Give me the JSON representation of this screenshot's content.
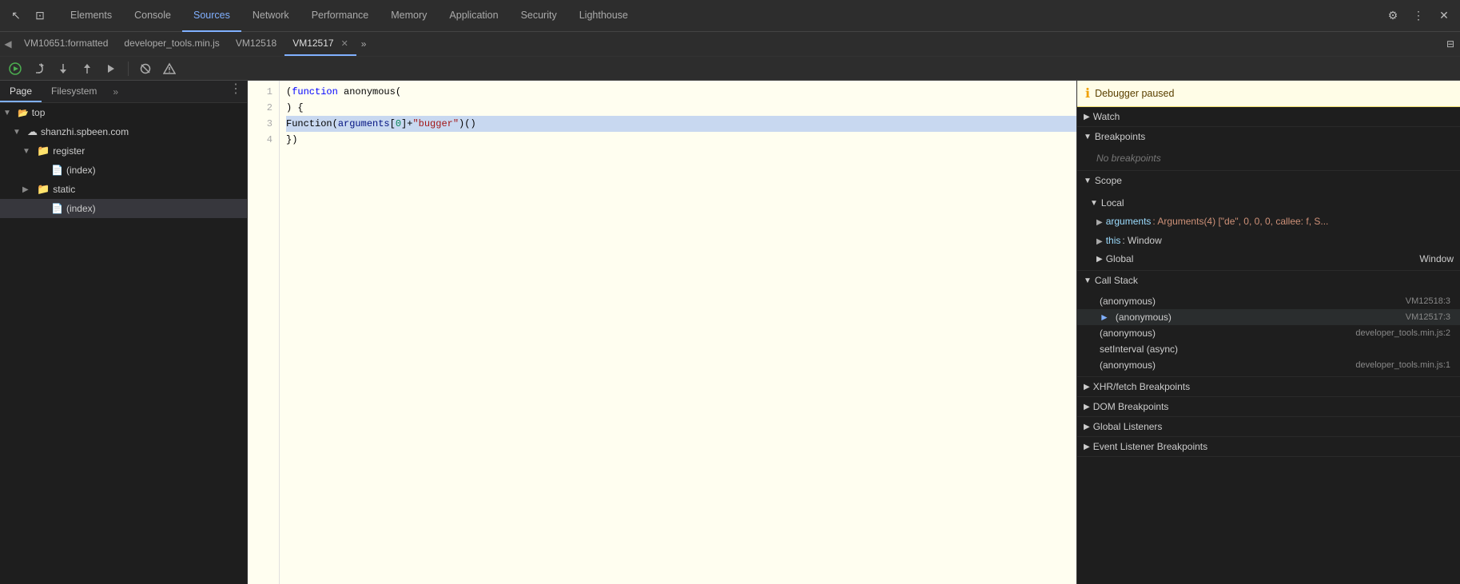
{
  "topbar": {
    "tabs": [
      {
        "label": "Elements",
        "active": false
      },
      {
        "label": "Console",
        "active": false
      },
      {
        "label": "Sources",
        "active": true
      },
      {
        "label": "Network",
        "active": false
      },
      {
        "label": "Performance",
        "active": false
      },
      {
        "label": "Memory",
        "active": false
      },
      {
        "label": "Application",
        "active": false
      },
      {
        "label": "Security",
        "active": false
      },
      {
        "label": "Lighthouse",
        "active": false
      }
    ],
    "settings_icon": "⚙",
    "more_icon": "⋮",
    "close_icon": "✕",
    "dock_icon": "⊡",
    "cursor_icon": "↖"
  },
  "sources_tabs": {
    "left_arrow": "◀",
    "file_tabs": [
      {
        "label": "VM10651:formatted",
        "active": false,
        "closeable": false
      },
      {
        "label": "developer_tools.min.js",
        "active": false,
        "closeable": false
      },
      {
        "label": "VM12518",
        "active": false,
        "closeable": false
      },
      {
        "label": "VM12517",
        "active": true,
        "closeable": true
      }
    ],
    "more_tabs": "»"
  },
  "filetree": {
    "tabs": [
      {
        "label": "Page",
        "active": true
      },
      {
        "label": "Filesystem",
        "active": false
      }
    ],
    "more": "»",
    "items": [
      {
        "label": "top",
        "indent": 0,
        "type": "arrow-down",
        "icon": "▼",
        "is_folder": true
      },
      {
        "label": "shanzhi.spbeen.com",
        "indent": 1,
        "type": "cloud",
        "icon": "☁",
        "is_folder": true,
        "expand": true
      },
      {
        "label": "register",
        "indent": 2,
        "type": "folder",
        "icon": "📁",
        "is_folder": true
      },
      {
        "label": "(index)",
        "indent": 3,
        "type": "file",
        "icon": "📄"
      },
      {
        "label": "static",
        "indent": 2,
        "type": "folder",
        "icon": "📁",
        "is_folder": true,
        "collapsed": true
      },
      {
        "label": "(index)",
        "indent": 3,
        "type": "file",
        "icon": "📄",
        "selected": true
      }
    ]
  },
  "editor": {
    "lines": [
      {
        "num": 1,
        "code": "(function anonymous(",
        "highlight": false
      },
      {
        "num": 2,
        "code": ") {",
        "highlight": false
      },
      {
        "num": 3,
        "code": "Function(arguments[0]+\"bugger\")()",
        "highlight": true
      },
      {
        "num": 4,
        "code": "})",
        "highlight": false
      }
    ]
  },
  "rightpanel": {
    "debugger_paused": "Debugger paused",
    "sections": [
      {
        "id": "watch",
        "label": "Watch",
        "expanded": false,
        "content": []
      },
      {
        "id": "breakpoints",
        "label": "Breakpoints",
        "expanded": true,
        "content": [
          {
            "text": "No breakpoints"
          }
        ]
      },
      {
        "id": "scope",
        "label": "Scope",
        "expanded": true,
        "subsections": [
          {
            "label": "Local",
            "expanded": true,
            "items": [
              {
                "key": "arguments",
                "value": "Arguments(4) [\"de\", 0, 0, 0, callee: f, S..."
              },
              {
                "key": "this",
                "value": "Window"
              }
            ]
          },
          {
            "label": "Global",
            "expanded": false,
            "value": "Window"
          }
        ]
      },
      {
        "id": "callstack",
        "label": "Call Stack",
        "expanded": true,
        "items": [
          {
            "name": "(anonymous)",
            "file": "VM12518:3",
            "active": false
          },
          {
            "name": "(anonymous)",
            "file": "VM12517:3",
            "active": true,
            "arrow": true
          },
          {
            "name": "(anonymous)",
            "file": "developer_tools.min.js:2",
            "active": false
          },
          {
            "name": "setInterval (async)",
            "file": "",
            "active": false
          },
          {
            "name": "(anonymous)",
            "file": "developer_tools.min.js:1",
            "active": false
          }
        ]
      },
      {
        "id": "xhr-breakpoints",
        "label": "XHR/fetch Breakpoints",
        "expanded": false
      },
      {
        "id": "dom-breakpoints",
        "label": "DOM Breakpoints",
        "expanded": false
      },
      {
        "id": "global-listeners",
        "label": "Global Listeners",
        "expanded": false
      },
      {
        "id": "event-listener-breakpoints",
        "label": "Event Listener Breakpoints",
        "expanded": false
      }
    ]
  },
  "debug_toolbar": {
    "resume_label": "Resume",
    "step_over_label": "Step over",
    "step_into_label": "Step into",
    "step_out_label": "Step out",
    "step_label": "Step",
    "deactivate_label": "Deactivate breakpoints",
    "pause_label": "Pause on exceptions"
  }
}
